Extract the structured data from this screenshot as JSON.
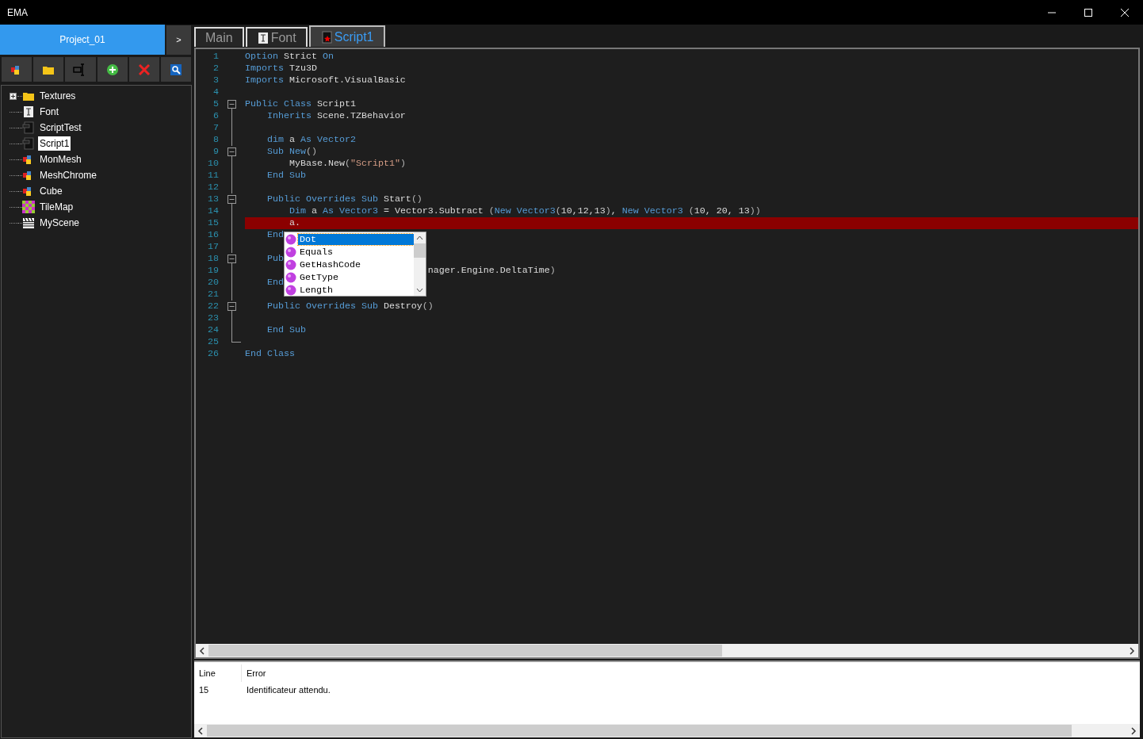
{
  "window": {
    "title": "EMA"
  },
  "project": {
    "name": "Project_01",
    "expand_button": ">"
  },
  "tree": [
    {
      "label": "Textures",
      "kind": "folder",
      "expanded": false,
      "selected": false
    },
    {
      "label": "Font",
      "kind": "font",
      "selected": false
    },
    {
      "label": "ScriptTest",
      "kind": "script",
      "selected": false
    },
    {
      "label": "Script1",
      "kind": "script",
      "selected": true
    },
    {
      "label": "MonMesh",
      "kind": "mesh",
      "selected": false
    },
    {
      "label": "MeshChrome",
      "kind": "mesh",
      "selected": false
    },
    {
      "label": "Cube",
      "kind": "mesh",
      "selected": false
    },
    {
      "label": "TileMap",
      "kind": "tilemap",
      "selected": false
    },
    {
      "label": "MyScene",
      "kind": "scene",
      "selected": false
    }
  ],
  "tabs": [
    {
      "label": "Main",
      "kind": "plain",
      "selected": false
    },
    {
      "label": "Font",
      "kind": "font",
      "selected": false
    },
    {
      "label": "Script1",
      "kind": "script",
      "selected": true
    }
  ],
  "code_lines": [
    {
      "number": "1",
      "kind": "plain",
      "error": false,
      "segs": [
        {
          "kind": "keyword",
          "text": "Option"
        },
        {
          "kind": "text",
          "text": " Strict "
        },
        {
          "kind": "keyword",
          "text": "On"
        }
      ]
    },
    {
      "number": "2",
      "kind": "plain",
      "error": false,
      "segs": [
        {
          "kind": "keyword",
          "text": "Imports"
        },
        {
          "kind": "text",
          "text": " Tzu3D"
        }
      ]
    },
    {
      "number": "3",
      "kind": "plain",
      "error": false,
      "segs": [
        {
          "kind": "keyword",
          "text": "Imports"
        },
        {
          "kind": "text",
          "text": " Microsoft.VisualBasic"
        }
      ]
    },
    {
      "number": "4",
      "kind": "plain",
      "error": false
    },
    {
      "number": "5",
      "kind": "start",
      "error": false,
      "segs": [
        {
          "kind": "keyword",
          "text": "Public Class"
        },
        {
          "kind": "text",
          "text": " Script1"
        }
      ]
    },
    {
      "number": "6",
      "kind": "body",
      "error": false,
      "segs": [
        {
          "kind": "keyword",
          "text": "    Inherits"
        },
        {
          "kind": "text",
          "text": " Scene.TZBehavior"
        }
      ]
    },
    {
      "number": "7",
      "kind": "body",
      "error": false
    },
    {
      "number": "8",
      "kind": "body",
      "error": false,
      "segs": [
        {
          "kind": "keyword",
          "text": "    dim"
        },
        {
          "kind": "text",
          "text": " a "
        },
        {
          "kind": "keyword",
          "text": "As Vector2"
        }
      ]
    },
    {
      "number": "9",
      "kind": "start",
      "error": false,
      "segs": [
        {
          "kind": "keyword",
          "text": "    Sub New"
        },
        {
          "kind": "punct",
          "text": "()"
        }
      ]
    },
    {
      "number": "10",
      "kind": "body",
      "error": false,
      "segs": [
        {
          "kind": "text",
          "text": "        MyBase.New"
        },
        {
          "kind": "punct",
          "text": "("
        },
        {
          "kind": "string",
          "text": "\"Script1\""
        },
        {
          "kind": "punct",
          "text": ")"
        }
      ]
    },
    {
      "number": "11",
      "kind": "body",
      "error": false,
      "segs": [
        {
          "kind": "keyword",
          "text": "    End Sub"
        }
      ]
    },
    {
      "number": "12",
      "kind": "body",
      "error": false
    },
    {
      "number": "13",
      "kind": "start",
      "error": false,
      "segs": [
        {
          "kind": "keyword",
          "text": "    Public Overrides Sub"
        },
        {
          "kind": "text",
          "text": " Start"
        },
        {
          "kind": "punct",
          "text": "()"
        }
      ]
    },
    {
      "number": "14",
      "kind": "body",
      "error": false,
      "segs": [
        {
          "kind": "keyword",
          "text": "        Dim"
        },
        {
          "kind": "text",
          "text": " a "
        },
        {
          "kind": "keyword",
          "text": "As Vector3"
        },
        {
          "kind": "text",
          "text": " = Vector3.Subtract "
        },
        {
          "kind": "punct",
          "text": "("
        },
        {
          "kind": "keyword",
          "text": "New Vector3"
        },
        {
          "kind": "punct",
          "text": "("
        },
        {
          "kind": "text",
          "text": "10,12,13"
        },
        {
          "kind": "punct",
          "text": ")"
        },
        {
          "kind": "text",
          "text": ", "
        },
        {
          "kind": "keyword",
          "text": "New Vector3"
        },
        {
          "kind": "punct",
          "text": " ("
        },
        {
          "kind": "text",
          "text": "10, 20, 13"
        },
        {
          "kind": "punct",
          "text": "))"
        }
      ]
    },
    {
      "number": "15",
      "kind": "body",
      "error": true,
      "segs": [
        {
          "kind": "text",
          "text": "        a."
        }
      ]
    },
    {
      "number": "16",
      "kind": "body",
      "error": false,
      "segs": [
        {
          "kind": "keyword",
          "text": "    End"
        }
      ]
    },
    {
      "number": "17",
      "kind": "body",
      "error": false
    },
    {
      "number": "18",
      "kind": "start",
      "error": false,
      "segs": [
        {
          "kind": "keyword",
          "text": "    Pub"
        }
      ]
    },
    {
      "number": "19",
      "kind": "body",
      "error": false,
      "segs": [
        {
          "kind": "text",
          "text": "                                 nager.Engine.DeltaTime"
        },
        {
          "kind": "punct",
          "text": ")"
        }
      ]
    },
    {
      "number": "20",
      "kind": "body",
      "error": false,
      "segs": [
        {
          "kind": "keyword",
          "text": "    End"
        }
      ]
    },
    {
      "number": "21",
      "kind": "body",
      "error": false
    },
    {
      "number": "22",
      "kind": "start",
      "error": false,
      "segs": [
        {
          "kind": "keyword",
          "text": "    Public Overrides Sub"
        },
        {
          "kind": "text",
          "text": " Destroy"
        },
        {
          "kind": "punct",
          "text": "()"
        }
      ]
    },
    {
      "number": "23",
      "kind": "body",
      "error": false
    },
    {
      "number": "24",
      "kind": "body",
      "error": false,
      "segs": [
        {
          "kind": "keyword",
          "text": "    End Sub"
        }
      ]
    },
    {
      "number": "25",
      "kind": "end",
      "error": false
    },
    {
      "number": "26",
      "kind": "plain",
      "error": false,
      "segs": [
        {
          "kind": "keyword",
          "text": "End Class"
        }
      ]
    }
  ],
  "autocomplete": [
    {
      "label": "Dot",
      "selected": true
    },
    {
      "label": "Equals",
      "selected": false
    },
    {
      "label": "GetHashCode",
      "selected": false
    },
    {
      "label": "GetType",
      "selected": false
    },
    {
      "label": "Length",
      "selected": false
    }
  ],
  "errors": {
    "columns": [
      "Line",
      "Error"
    ],
    "rows": [
      [
        "15",
        "Identificateur attendu."
      ]
    ]
  }
}
